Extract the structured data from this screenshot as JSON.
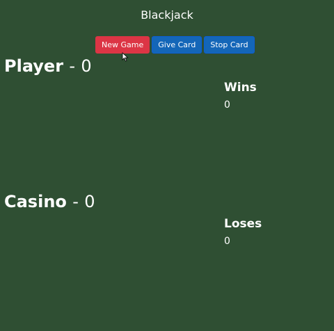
{
  "title": "Blackjack",
  "toolbar": {
    "new_game_label": "New Game",
    "give_card_label": "Give Card",
    "stop_card_label": "Stop Card"
  },
  "player": {
    "label": "Player",
    "separator": "-",
    "score": "0"
  },
  "casino": {
    "label": "Casino",
    "separator": "-",
    "score": "0"
  },
  "stats": {
    "wins_label": "Wins",
    "wins_value": "0",
    "loses_label": "Loses",
    "loses_value": "0"
  },
  "colors": {
    "background": "#2f4f33",
    "new_game_button": "#dc3545",
    "card_buttons": "#1466b8"
  },
  "icons": {
    "cursor": "mouse-pointer-icon"
  }
}
